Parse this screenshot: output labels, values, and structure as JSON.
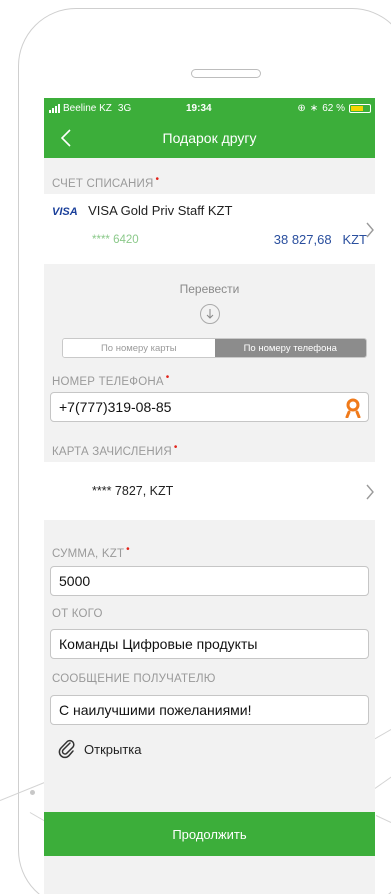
{
  "status_bar": {
    "carrier": "Beeline KZ",
    "network": "3G",
    "time": "19:34",
    "battery": "62 %"
  },
  "nav": {
    "title": "Подарок другу"
  },
  "debit_account": {
    "label": "СЧЕТ СПИСАНИЯ",
    "card_brand": "VISA",
    "card_name": "VISA Gold Priv Staff KZT",
    "masked_number": "**** 6420",
    "balance": "38 827,68",
    "currency": "KZT"
  },
  "transfer": {
    "label": "Перевести"
  },
  "mode_tabs": [
    {
      "label": "По номеру карты",
      "active": false
    },
    {
      "label": "По номеру телефона",
      "active": true
    }
  ],
  "phone": {
    "label": "НОМЕР ТЕЛЕФОНА",
    "value": "+7(777)319-08-85"
  },
  "credit_card": {
    "label": "КАРТА ЗАЧИСЛЕНИЯ",
    "value": "**** 7827, KZT"
  },
  "amount": {
    "label": "СУММА, KZT",
    "value": "5000"
  },
  "sender": {
    "label": "ОТ КОГО",
    "value": "Команды Цифровые продукты"
  },
  "message": {
    "label": "СООБЩЕНИЕ ПОЛУЧАТЕЛЮ",
    "value": "С наилучшими пожеланиями!"
  },
  "attachment": {
    "label": "Открытка"
  },
  "continue_button": {
    "label": "Продолжить"
  },
  "colors": {
    "brand_green": "#3cae3a",
    "required_red": "#e2231a",
    "link_blue": "#2a4f9e",
    "ok_orange": "#f07a1a"
  }
}
